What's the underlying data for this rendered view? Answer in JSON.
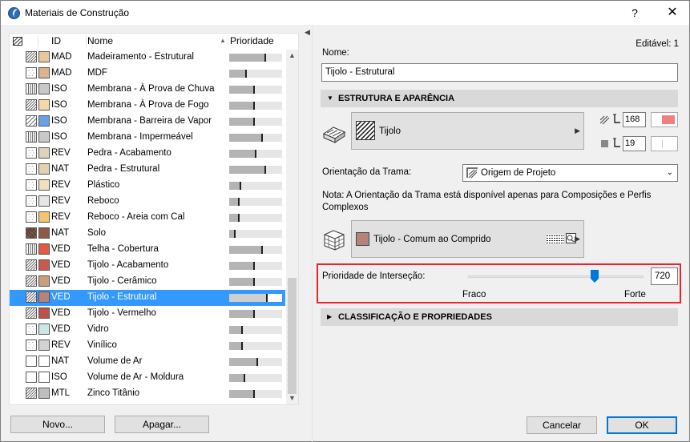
{
  "window": {
    "title": "Materiais de Construção",
    "help": "?",
    "close": "✕"
  },
  "list": {
    "headers": {
      "id": "ID",
      "name": "Nome",
      "priority": "Prioridade"
    },
    "rows": [
      {
        "id": "MAD",
        "name": "Madeiramento - Estrutural",
        "priority": 0.7,
        "color": "#e6c89a",
        "hatch": "diag",
        "selected": false
      },
      {
        "id": "MAD",
        "name": "MDF",
        "priority": 0.33,
        "color": "#d9b38c",
        "hatch": "dots",
        "selected": false
      },
      {
        "id": "ISO",
        "name": "Membrana - À Prova de Chuva",
        "priority": 0.48,
        "color": "#c8c8c8",
        "hatch": "vert",
        "selected": false
      },
      {
        "id": "ISO",
        "name": "Membrana - À Prova de Fogo",
        "priority": 0.48,
        "color": "#f2d9a6",
        "hatch": "diag",
        "selected": false
      },
      {
        "id": "ISO",
        "name": "Membrana - Barreira de Vapor",
        "priority": 0.48,
        "color": "#6aa0e8",
        "hatch": "diag2",
        "selected": false
      },
      {
        "id": "ISO",
        "name": "Membrana - Impermeável",
        "priority": 0.64,
        "color": "#c8c8c8",
        "hatch": "vert",
        "selected": false
      },
      {
        "id": "REV",
        "name": "Pedra - Acabamento",
        "priority": 0.52,
        "color": "#ddd2bc",
        "hatch": "dots",
        "selected": false
      },
      {
        "id": "NAT",
        "name": "Pedra - Estrutural",
        "priority": 0.7,
        "color": "#e1d2b4",
        "hatch": "dots",
        "selected": false
      },
      {
        "id": "REV",
        "name": "Plástico",
        "priority": 0.22,
        "color": "#f0e0c0",
        "hatch": "dots",
        "selected": false
      },
      {
        "id": "REV",
        "name": "Reboco",
        "priority": 0.2,
        "color": "#e6e6e6",
        "hatch": "dots",
        "selected": false
      },
      {
        "id": "REV",
        "name": "Reboco - Areia com Cal",
        "priority": 0.2,
        "color": "#f5c46e",
        "hatch": "dots",
        "selected": false
      },
      {
        "id": "NAT",
        "name": "Solo",
        "priority": 0.12,
        "color": "#8c5a46",
        "hatch": "cross",
        "selected": false
      },
      {
        "id": "VED",
        "name": "Telha - Cobertura",
        "priority": 0.64,
        "color": "#e05a46",
        "hatch": "vert",
        "selected": false
      },
      {
        "id": "VED",
        "name": "Tijolo - Acabamento",
        "priority": 0.48,
        "color": "#c85a4a",
        "hatch": "diag",
        "selected": false
      },
      {
        "id": "VED",
        "name": "Tijolo - Cerâmico",
        "priority": 0.48,
        "color": "#c8a07a",
        "hatch": "diag",
        "selected": false
      },
      {
        "id": "VED",
        "name": "Tijolo - Estrutural",
        "priority": 0.72,
        "color": "#b5837a",
        "hatch": "diag",
        "selected": true
      },
      {
        "id": "VED",
        "name": "Tijolo - Vermelho",
        "priority": 0.48,
        "color": "#c0504a",
        "hatch": "diag",
        "selected": false
      },
      {
        "id": "VED",
        "name": "Vidro",
        "priority": 0.25,
        "color": "#cce6e6",
        "hatch": "dots",
        "selected": false
      },
      {
        "id": "REV",
        "name": "Vinílico",
        "priority": 0.25,
        "color": "#d2d2d2",
        "hatch": "dots",
        "selected": false
      },
      {
        "id": "NAT",
        "name": "Volume de Ar",
        "priority": 0.55,
        "color": "#ffffff",
        "hatch": "none",
        "selected": false
      },
      {
        "id": "ISO",
        "name": "Volume de Ar - Moldura",
        "priority": 0.3,
        "color": "#ffffff",
        "hatch": "none",
        "selected": false
      },
      {
        "id": "MTL",
        "name": "Zinco Titânio",
        "priority": 0.48,
        "color": "#bebebe",
        "hatch": "diag",
        "selected": false
      }
    ]
  },
  "buttons": {
    "new": "Novo...",
    "delete": "Apagar...",
    "cancel": "Cancelar",
    "ok": "OK"
  },
  "details": {
    "editable": "Editável: 1",
    "name_label": "Nome:",
    "name_value": "Tijolo - Estrutural",
    "structure_section": "ESTRUTURA E APARÊNCIA",
    "fill_name": "Tijolo",
    "cut_pen": "168",
    "cut_pen_color": "#f08080",
    "bg_pen": "19",
    "bg_pen_color": "#ffffff",
    "orientation_label": "Orientação da Trama:",
    "orientation_value": "Origem de Projeto",
    "note": "Nota: A Orientação da Trama está disponível apenas para Composições e Perfis Complexos",
    "surface_name": "Tijolo - Comum ao Comprido",
    "surface_color": "#b5837a",
    "intersection_label": "Prioridade de Interseção:",
    "intersection_value": "720",
    "intersection_fraction": 0.72,
    "weak_label": "Fraco",
    "strong_label": "Forte",
    "classification_section": "CLASSIFICAÇÃO E PROPRIEDADES"
  },
  "icons": [
    "app-icon",
    "material-column-icon",
    "sort-arrow-icon",
    "scroll-up-icon",
    "scroll-down-icon",
    "collapse-arrow-icon",
    "cut-fill-icon",
    "pen-icon",
    "hatch-orientation-icon",
    "surface-icon",
    "texture-icon",
    "chevron-down-icon"
  ]
}
